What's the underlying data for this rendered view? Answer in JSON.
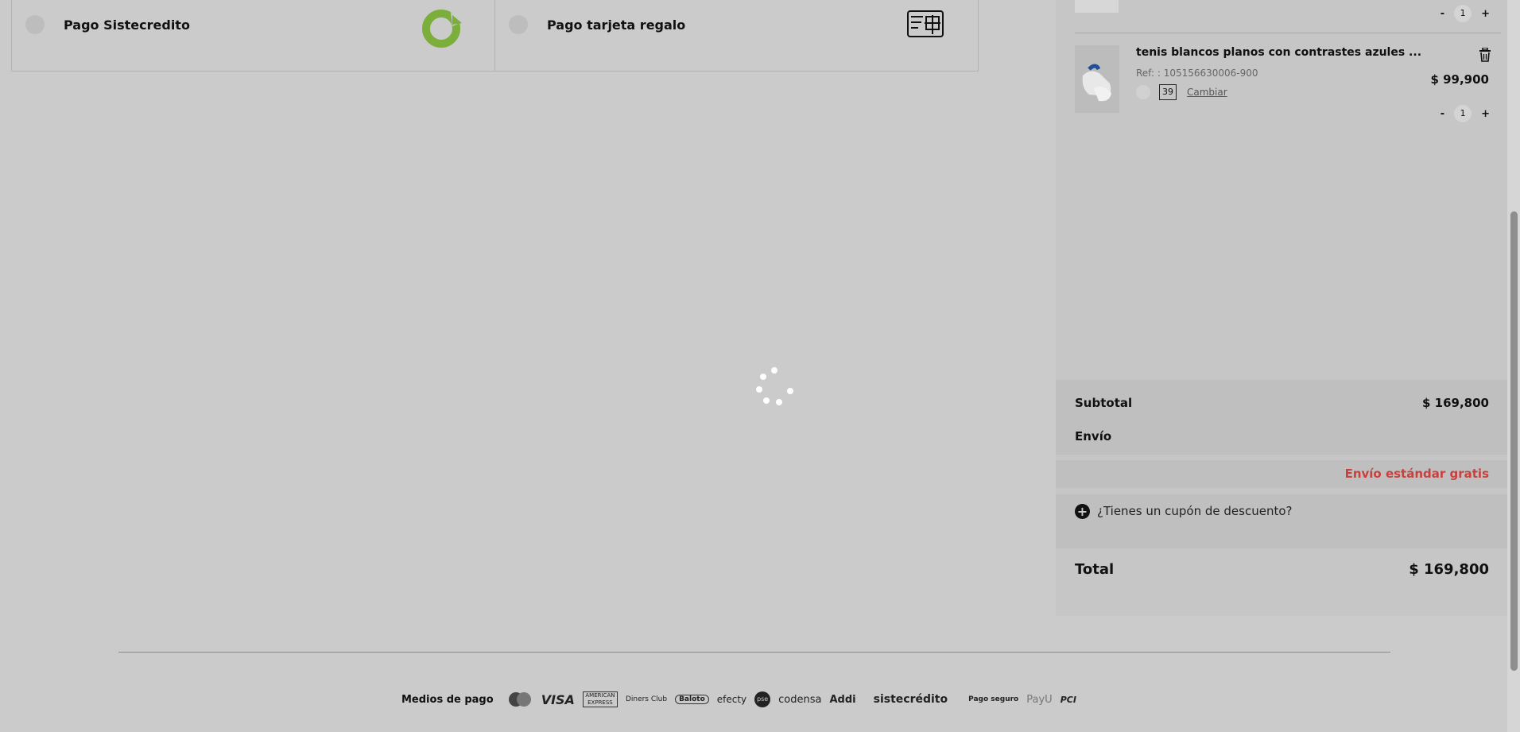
{
  "payment_options": [
    {
      "label": "Pago Sistecredito",
      "icon": "sistecredito-logo-icon",
      "icon_color": "#7cae3b"
    },
    {
      "label": "Pago tarjeta regalo",
      "icon": "gift-card-icon"
    }
  ],
  "cart": {
    "top_item_qty": "1",
    "item": {
      "name": "tenis blancos planos con contrastes azules ...",
      "ref": "Ref: : 105156630006-900",
      "size": "39",
      "change_label": "Cambiar",
      "price": "$ 99,900",
      "qty": "1",
      "minus": "-",
      "plus": "+"
    },
    "summary": {
      "subtotal_label": "Subtotal",
      "subtotal_value": "$ 169,800",
      "shipping_label": "Envío",
      "shipping_value": "Envío estándar gratis",
      "coupon_text": "¿Tienes un cupón de descuento?",
      "total_label": "Total",
      "total_value": "$ 169,800"
    }
  },
  "footer": {
    "payment_methods_label": "Medios de pago",
    "brands": [
      "VISA",
      "efecty",
      "codensa",
      "Addi",
      "sistecrédito"
    ],
    "secure_label": "Pago seguro",
    "payu": "PayU",
    "pci": "PCI",
    "amex": "AMERICAN EXPRESS",
    "diners": "Diners Club",
    "baloto": "Baloto",
    "pse": "pse",
    "mastercard": "MasterCard"
  },
  "colors": {
    "accent_red": "#c8413d",
    "background": "#cbcbcb",
    "panel": "#c6c6c6"
  }
}
